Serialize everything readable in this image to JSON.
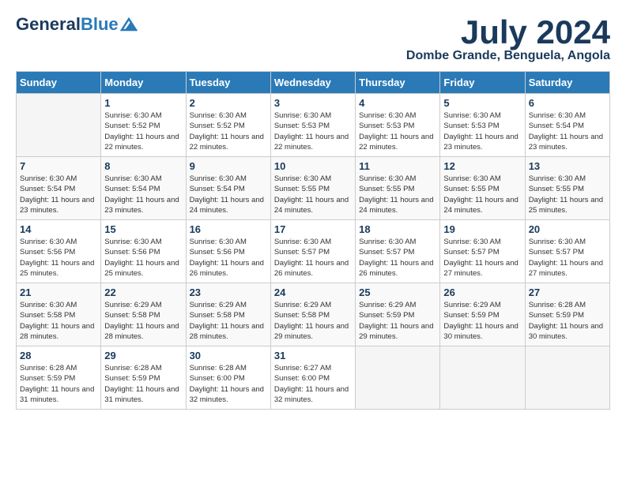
{
  "header": {
    "logo_general": "General",
    "logo_blue": "Blue",
    "month": "July 2024",
    "location": "Dombe Grande, Benguela, Angola"
  },
  "calendar": {
    "days_of_week": [
      "Sunday",
      "Monday",
      "Tuesday",
      "Wednesday",
      "Thursday",
      "Friday",
      "Saturday"
    ],
    "weeks": [
      [
        {
          "day": "",
          "empty": true
        },
        {
          "day": "1",
          "sunrise": "Sunrise: 6:30 AM",
          "sunset": "Sunset: 5:52 PM",
          "daylight": "Daylight: 11 hours and 22 minutes."
        },
        {
          "day": "2",
          "sunrise": "Sunrise: 6:30 AM",
          "sunset": "Sunset: 5:52 PM",
          "daylight": "Daylight: 11 hours and 22 minutes."
        },
        {
          "day": "3",
          "sunrise": "Sunrise: 6:30 AM",
          "sunset": "Sunset: 5:53 PM",
          "daylight": "Daylight: 11 hours and 22 minutes."
        },
        {
          "day": "4",
          "sunrise": "Sunrise: 6:30 AM",
          "sunset": "Sunset: 5:53 PM",
          "daylight": "Daylight: 11 hours and 22 minutes."
        },
        {
          "day": "5",
          "sunrise": "Sunrise: 6:30 AM",
          "sunset": "Sunset: 5:53 PM",
          "daylight": "Daylight: 11 hours and 23 minutes."
        },
        {
          "day": "6",
          "sunrise": "Sunrise: 6:30 AM",
          "sunset": "Sunset: 5:54 PM",
          "daylight": "Daylight: 11 hours and 23 minutes."
        }
      ],
      [
        {
          "day": "7",
          "sunrise": "Sunrise: 6:30 AM",
          "sunset": "Sunset: 5:54 PM",
          "daylight": "Daylight: 11 hours and 23 minutes."
        },
        {
          "day": "8",
          "sunrise": "Sunrise: 6:30 AM",
          "sunset": "Sunset: 5:54 PM",
          "daylight": "Daylight: 11 hours and 23 minutes."
        },
        {
          "day": "9",
          "sunrise": "Sunrise: 6:30 AM",
          "sunset": "Sunset: 5:54 PM",
          "daylight": "Daylight: 11 hours and 24 minutes."
        },
        {
          "day": "10",
          "sunrise": "Sunrise: 6:30 AM",
          "sunset": "Sunset: 5:55 PM",
          "daylight": "Daylight: 11 hours and 24 minutes."
        },
        {
          "day": "11",
          "sunrise": "Sunrise: 6:30 AM",
          "sunset": "Sunset: 5:55 PM",
          "daylight": "Daylight: 11 hours and 24 minutes."
        },
        {
          "day": "12",
          "sunrise": "Sunrise: 6:30 AM",
          "sunset": "Sunset: 5:55 PM",
          "daylight": "Daylight: 11 hours and 24 minutes."
        },
        {
          "day": "13",
          "sunrise": "Sunrise: 6:30 AM",
          "sunset": "Sunset: 5:55 PM",
          "daylight": "Daylight: 11 hours and 25 minutes."
        }
      ],
      [
        {
          "day": "14",
          "sunrise": "Sunrise: 6:30 AM",
          "sunset": "Sunset: 5:56 PM",
          "daylight": "Daylight: 11 hours and 25 minutes."
        },
        {
          "day": "15",
          "sunrise": "Sunrise: 6:30 AM",
          "sunset": "Sunset: 5:56 PM",
          "daylight": "Daylight: 11 hours and 25 minutes."
        },
        {
          "day": "16",
          "sunrise": "Sunrise: 6:30 AM",
          "sunset": "Sunset: 5:56 PM",
          "daylight": "Daylight: 11 hours and 26 minutes."
        },
        {
          "day": "17",
          "sunrise": "Sunrise: 6:30 AM",
          "sunset": "Sunset: 5:57 PM",
          "daylight": "Daylight: 11 hours and 26 minutes."
        },
        {
          "day": "18",
          "sunrise": "Sunrise: 6:30 AM",
          "sunset": "Sunset: 5:57 PM",
          "daylight": "Daylight: 11 hours and 26 minutes."
        },
        {
          "day": "19",
          "sunrise": "Sunrise: 6:30 AM",
          "sunset": "Sunset: 5:57 PM",
          "daylight": "Daylight: 11 hours and 27 minutes."
        },
        {
          "day": "20",
          "sunrise": "Sunrise: 6:30 AM",
          "sunset": "Sunset: 5:57 PM",
          "daylight": "Daylight: 11 hours and 27 minutes."
        }
      ],
      [
        {
          "day": "21",
          "sunrise": "Sunrise: 6:30 AM",
          "sunset": "Sunset: 5:58 PM",
          "daylight": "Daylight: 11 hours and 28 minutes."
        },
        {
          "day": "22",
          "sunrise": "Sunrise: 6:29 AM",
          "sunset": "Sunset: 5:58 PM",
          "daylight": "Daylight: 11 hours and 28 minutes."
        },
        {
          "day": "23",
          "sunrise": "Sunrise: 6:29 AM",
          "sunset": "Sunset: 5:58 PM",
          "daylight": "Daylight: 11 hours and 28 minutes."
        },
        {
          "day": "24",
          "sunrise": "Sunrise: 6:29 AM",
          "sunset": "Sunset: 5:58 PM",
          "daylight": "Daylight: 11 hours and 29 minutes."
        },
        {
          "day": "25",
          "sunrise": "Sunrise: 6:29 AM",
          "sunset": "Sunset: 5:59 PM",
          "daylight": "Daylight: 11 hours and 29 minutes."
        },
        {
          "day": "26",
          "sunrise": "Sunrise: 6:29 AM",
          "sunset": "Sunset: 5:59 PM",
          "daylight": "Daylight: 11 hours and 30 minutes."
        },
        {
          "day": "27",
          "sunrise": "Sunrise: 6:28 AM",
          "sunset": "Sunset: 5:59 PM",
          "daylight": "Daylight: 11 hours and 30 minutes."
        }
      ],
      [
        {
          "day": "28",
          "sunrise": "Sunrise: 6:28 AM",
          "sunset": "Sunset: 5:59 PM",
          "daylight": "Daylight: 11 hours and 31 minutes."
        },
        {
          "day": "29",
          "sunrise": "Sunrise: 6:28 AM",
          "sunset": "Sunset: 5:59 PM",
          "daylight": "Daylight: 11 hours and 31 minutes."
        },
        {
          "day": "30",
          "sunrise": "Sunrise: 6:28 AM",
          "sunset": "Sunset: 6:00 PM",
          "daylight": "Daylight: 11 hours and 32 minutes."
        },
        {
          "day": "31",
          "sunrise": "Sunrise: 6:27 AM",
          "sunset": "Sunset: 6:00 PM",
          "daylight": "Daylight: 11 hours and 32 minutes."
        },
        {
          "day": "",
          "empty": true
        },
        {
          "day": "",
          "empty": true
        },
        {
          "day": "",
          "empty": true
        }
      ]
    ]
  }
}
